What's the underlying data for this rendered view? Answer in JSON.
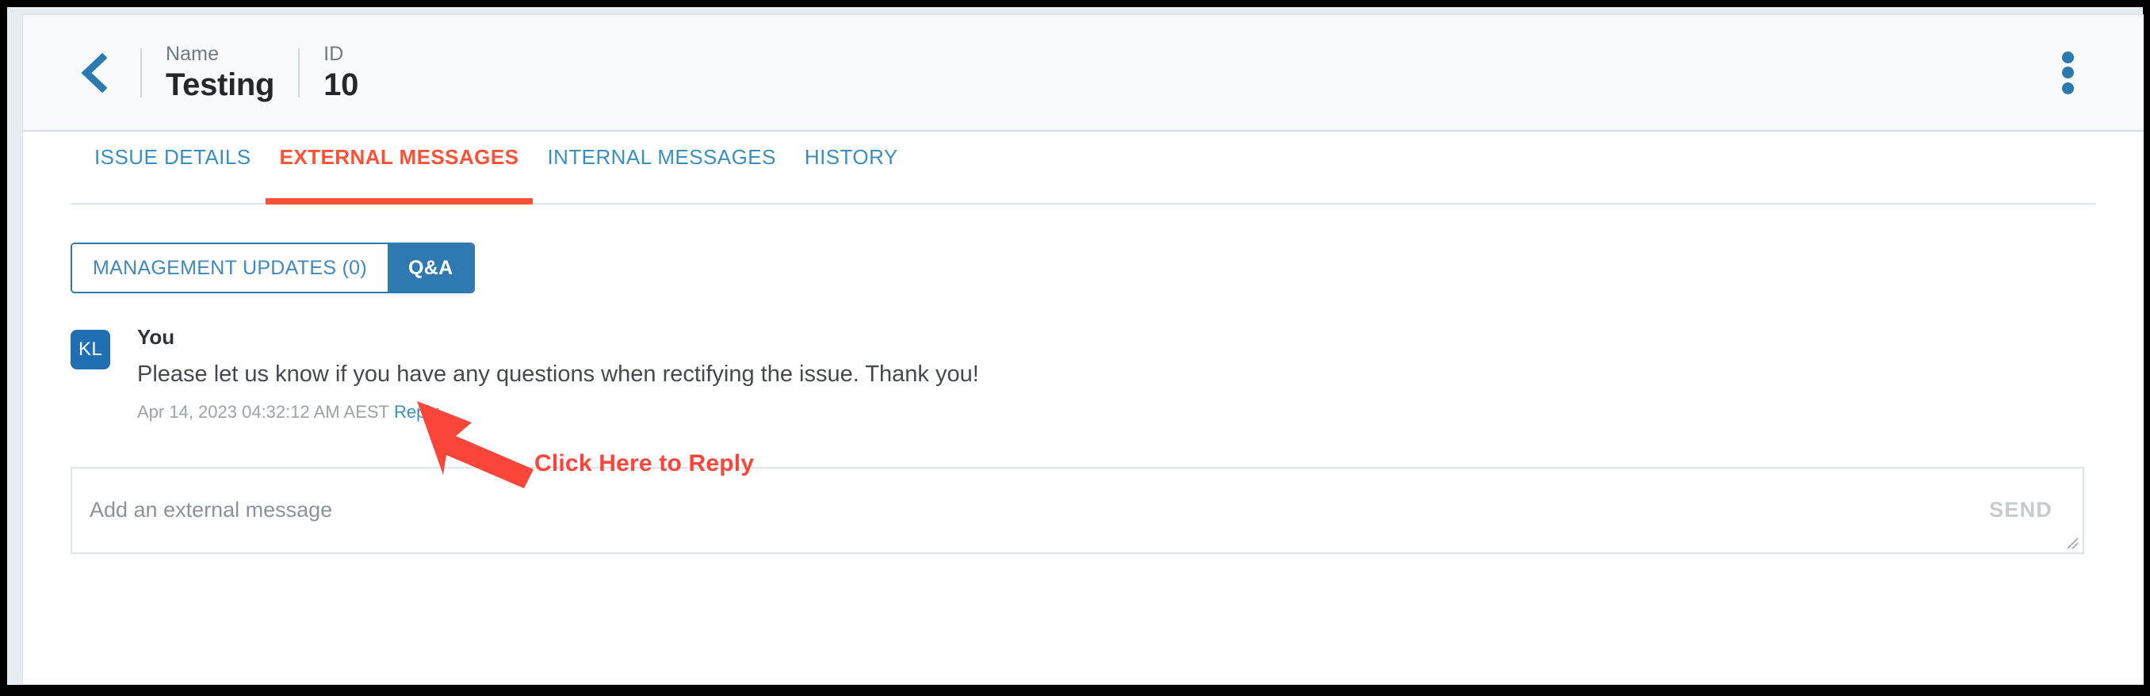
{
  "header": {
    "back_icon": "chevron-left-icon",
    "fields": [
      {
        "label": "Name",
        "value": "Testing"
      },
      {
        "label": "ID",
        "value": "10"
      }
    ],
    "menu_icon": "kebab-menu-icon"
  },
  "tabs": [
    {
      "label": "ISSUE DETAILS",
      "active": false
    },
    {
      "label": "EXTERNAL MESSAGES",
      "active": true
    },
    {
      "label": "INTERNAL MESSAGES",
      "active": false
    },
    {
      "label": "HISTORY",
      "active": false
    }
  ],
  "segmented": [
    {
      "label": "MANAGEMENT UPDATES (0)",
      "selected": false
    },
    {
      "label": "Q&A",
      "selected": true
    }
  ],
  "messages": [
    {
      "avatar_initials": "KL",
      "author": "You",
      "text": "Please let us know if you have any questions when rectifying the issue. Thank you!",
      "timestamp": "Apr 14, 2023 04:32:12 AM AEST",
      "reply_label": "Reply"
    }
  ],
  "composer": {
    "value": "",
    "placeholder": "Add an external message",
    "send_label": "SEND",
    "resize_icon": "resize-handle-icon"
  },
  "annotation": {
    "label": "Click Here to Reply",
    "arrow_icon": "arrow-up-left-icon",
    "color": "#f9453a"
  },
  "colors": {
    "accent_blue": "#2e7ab0",
    "link_blue": "#3a8ec0",
    "active_tab": "#fb5137",
    "annotation_red": "#f9453a",
    "avatar_blue": "#1f6fb2",
    "header_bg": "#f8fafb",
    "frame": "#000000"
  }
}
